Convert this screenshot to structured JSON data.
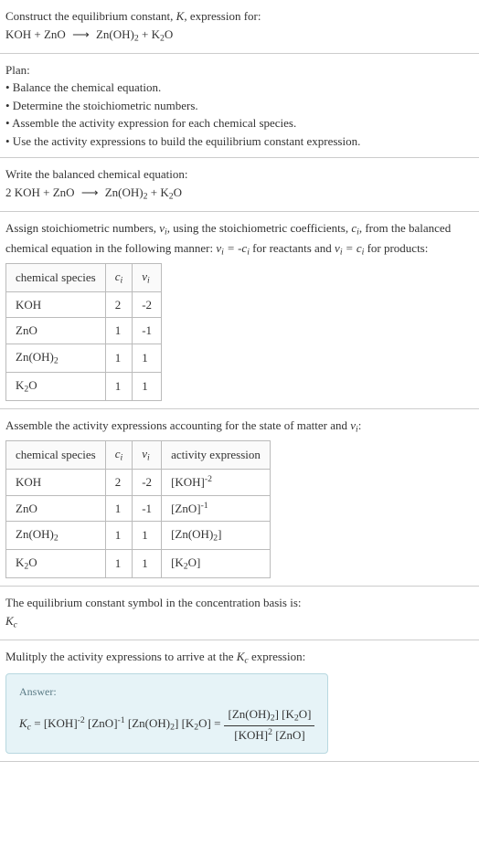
{
  "intro": {
    "line1": "Construct the equilibrium constant, ",
    "K": "K",
    "line1b": ", expression for:",
    "equation": "KOH + ZnO ⟶ Zn(OH)₂ + K₂O"
  },
  "plan": {
    "heading": "Plan:",
    "b1": "• Balance the chemical equation.",
    "b2": "• Determine the stoichiometric numbers.",
    "b3": "• Assemble the activity expression for each chemical species.",
    "b4": "• Use the activity expressions to build the equilibrium constant expression."
  },
  "balanced": {
    "heading": "Write the balanced chemical equation:",
    "equation": "2 KOH + ZnO ⟶ Zn(OH)₂ + K₂O"
  },
  "assign": {
    "text_a": "Assign stoichiometric numbers, ",
    "nu": "νᵢ",
    "text_b": ", using the stoichiometric coefficients, ",
    "ci": "cᵢ",
    "text_c": ", from the balanced chemical equation in the following manner: ",
    "rel1": "νᵢ = -cᵢ",
    "text_d": " for reactants and ",
    "rel2": "νᵢ = cᵢ",
    "text_e": " for products:",
    "headers": [
      "chemical species",
      "cᵢ",
      "νᵢ"
    ],
    "rows": [
      [
        "KOH",
        "2",
        "-2"
      ],
      [
        "ZnO",
        "1",
        "-1"
      ],
      [
        "Zn(OH)₂",
        "1",
        "1"
      ],
      [
        "K₂O",
        "1",
        "1"
      ]
    ]
  },
  "activity": {
    "heading_a": "Assemble the activity expressions accounting for the state of matter and ",
    "nu": "νᵢ",
    "heading_b": ":",
    "headers": [
      "chemical species",
      "cᵢ",
      "νᵢ",
      "activity expression"
    ],
    "rows": [
      [
        "KOH",
        "2",
        "-2",
        "[KOH]⁻²"
      ],
      [
        "ZnO",
        "1",
        "-1",
        "[ZnO]⁻¹"
      ],
      [
        "Zn(OH)₂",
        "1",
        "1",
        "[Zn(OH)₂]"
      ],
      [
        "K₂O",
        "1",
        "1",
        "[K₂O]"
      ]
    ]
  },
  "symbol": {
    "line": "The equilibrium constant symbol in the concentration basis is:",
    "kc": "K꜀"
  },
  "multiply": {
    "line_a": "Mulitply the activity expressions to arrive at the ",
    "kc": "K꜀",
    "line_b": " expression:"
  },
  "answer": {
    "label": "Answer:",
    "lhs": "K꜀ = [KOH]⁻² [ZnO]⁻¹ [Zn(OH)₂] [K₂O] = ",
    "num": "[Zn(OH)₂] [K₂O]",
    "den": "[KOH]² [ZnO]"
  },
  "chart_data": {
    "type": "table",
    "tables": [
      {
        "title": "Stoichiometric numbers",
        "headers": [
          "chemical species",
          "c_i",
          "ν_i"
        ],
        "rows": [
          [
            "KOH",
            2,
            -2
          ],
          [
            "ZnO",
            1,
            -1
          ],
          [
            "Zn(OH)2",
            1,
            1
          ],
          [
            "K2O",
            1,
            1
          ]
        ]
      },
      {
        "title": "Activity expressions",
        "headers": [
          "chemical species",
          "c_i",
          "ν_i",
          "activity expression"
        ],
        "rows": [
          [
            "KOH",
            2,
            -2,
            "[KOH]^-2"
          ],
          [
            "ZnO",
            1,
            -1,
            "[ZnO]^-1"
          ],
          [
            "Zn(OH)2",
            1,
            1,
            "[Zn(OH)2]"
          ],
          [
            "K2O",
            1,
            1,
            "[K2O]"
          ]
        ]
      }
    ]
  }
}
